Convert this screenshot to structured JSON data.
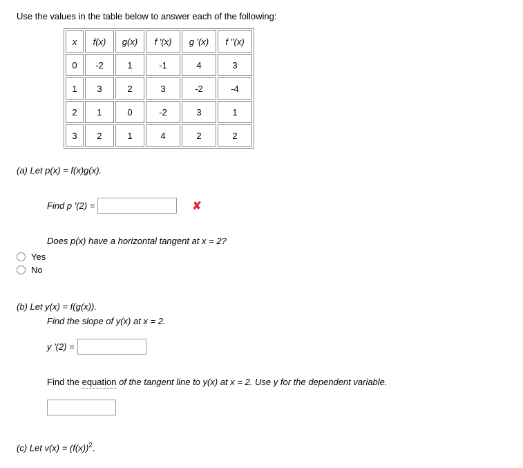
{
  "prompt": "Use the values in the table below to answer each of the following:",
  "table": {
    "headers": [
      "x",
      "f(x)",
      "g(x)",
      "f '(x)",
      "g '(x)",
      "f ''(x)"
    ],
    "rows": [
      [
        "0",
        "-2",
        "1",
        "-1",
        "4",
        "3"
      ],
      [
        "1",
        "3",
        "2",
        "3",
        "-2",
        "-4"
      ],
      [
        "2",
        "1",
        "0",
        "-2",
        "3",
        "1"
      ],
      [
        "3",
        "2",
        "1",
        "4",
        "2",
        "2"
      ]
    ]
  },
  "partA": {
    "label": "(a) Let p(x) = f(x)g(x).",
    "find_label": "Find p '(2) =",
    "input_value": "",
    "sub_question": "Does p(x) have a horizontal tangent at x = 2?",
    "opt_yes": "Yes",
    "opt_no": "No"
  },
  "partB": {
    "label": "(b) Let y(x) = f(g(x)).",
    "slope_prompt": "Find the slope of y(x) at x = 2.",
    "slope_label": "y '(2) =",
    "slope_value": "",
    "tangent_prompt_pre": "Find the ",
    "tangent_prompt_underlined": "equation",
    "tangent_prompt_post": " of the tangent line to y(x) at x = 2. Use y for the dependent variable.",
    "tangent_value": ""
  },
  "partC": {
    "label_pre": "(c) Let v(x) = (f(x))",
    "label_sup": "2",
    "label_post": "."
  }
}
